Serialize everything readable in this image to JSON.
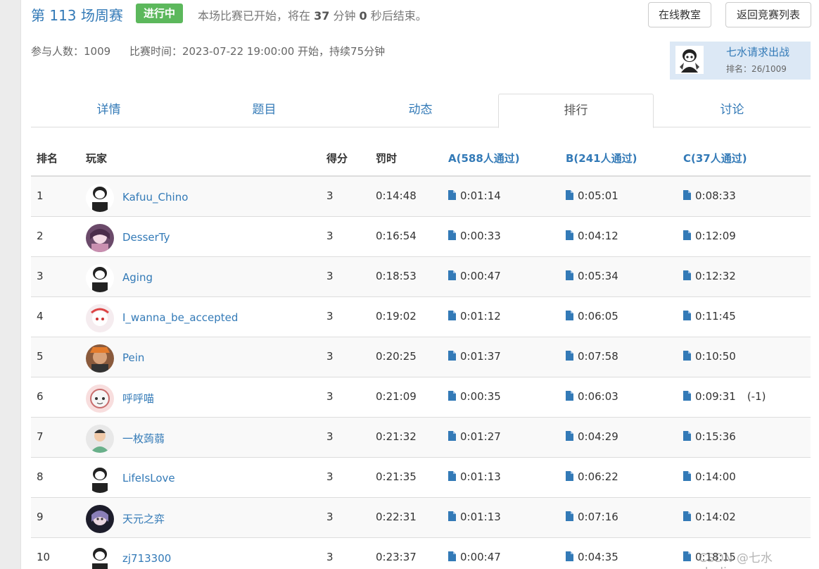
{
  "header": {
    "title": "第 113 场周赛",
    "status_badge": "进行中",
    "status_prefix": "本场比赛已开始，将在 ",
    "remaining_minutes": "37",
    "minutes_unit": " 分钟 ",
    "remaining_seconds": "0",
    "status_suffix": " 秒后结束。",
    "classroom_button": "在线教室",
    "back_button": "返回竞赛列表"
  },
  "meta": {
    "participants": "参与人数：1009",
    "contest_time": "比赛时间：2023-07-22 19:00:00 开始，持续75分钟"
  },
  "user_card": {
    "name": "七水请求出战",
    "rank": "排名：26/1009"
  },
  "tabs": [
    "详情",
    "题目",
    "动态",
    "排行",
    "讨论"
  ],
  "active_tab": "排行",
  "table": {
    "headers": {
      "rank": "排名",
      "player": "玩家",
      "score": "得分",
      "penalty": "罚时",
      "a": "A(588人通过)",
      "b": "B(241人通过)",
      "c": "C(37人通过)"
    },
    "rows": [
      {
        "rank": "1",
        "name": "Kafuu_Chino",
        "score": "3",
        "penalty": "0:14:48",
        "a": "0:01:14",
        "b": "0:05:01",
        "c": "0:08:33",
        "c_note": ""
      },
      {
        "rank": "2",
        "name": "DesserTy",
        "score": "3",
        "penalty": "0:16:54",
        "a": "0:00:33",
        "b": "0:04:12",
        "c": "0:12:09",
        "c_note": ""
      },
      {
        "rank": "3",
        "name": "Aging",
        "score": "3",
        "penalty": "0:18:53",
        "a": "0:00:47",
        "b": "0:05:34",
        "c": "0:12:32",
        "c_note": ""
      },
      {
        "rank": "4",
        "name": "I_wanna_be_accepted",
        "score": "3",
        "penalty": "0:19:02",
        "a": "0:01:12",
        "b": "0:06:05",
        "c": "0:11:45",
        "c_note": ""
      },
      {
        "rank": "5",
        "name": "Pein",
        "score": "3",
        "penalty": "0:20:25",
        "a": "0:01:37",
        "b": "0:07:58",
        "c": "0:10:50",
        "c_note": ""
      },
      {
        "rank": "6",
        "name": "呼呼喵",
        "score": "3",
        "penalty": "0:21:09",
        "a": "0:00:35",
        "b": "0:06:03",
        "c": "0:09:31",
        "c_note": "(-1)"
      },
      {
        "rank": "7",
        "name": "一枚蒟蒻",
        "score": "3",
        "penalty": "0:21:32",
        "a": "0:01:27",
        "b": "0:04:29",
        "c": "0:15:36",
        "c_note": ""
      },
      {
        "rank": "8",
        "name": "LifeIsLove",
        "score": "3",
        "penalty": "0:21:35",
        "a": "0:01:13",
        "b": "0:06:22",
        "c": "0:14:00",
        "c_note": ""
      },
      {
        "rank": "9",
        "name": "天元之弈",
        "score": "3",
        "penalty": "0:22:31",
        "a": "0:01:13",
        "b": "0:07:16",
        "c": "0:14:02",
        "c_note": ""
      },
      {
        "rank": "10",
        "name": "zj713300",
        "score": "3",
        "penalty": "0:23:37",
        "a": "0:00:47",
        "b": "0:04:35",
        "c": "0:18:15",
        "c_note": ""
      }
    ]
  },
  "watermark": "CSDN @七水shuliang",
  "colors": {
    "link": "#337ab7",
    "badge": "#5cb85c",
    "user_card_bg": "#dce8f5"
  }
}
